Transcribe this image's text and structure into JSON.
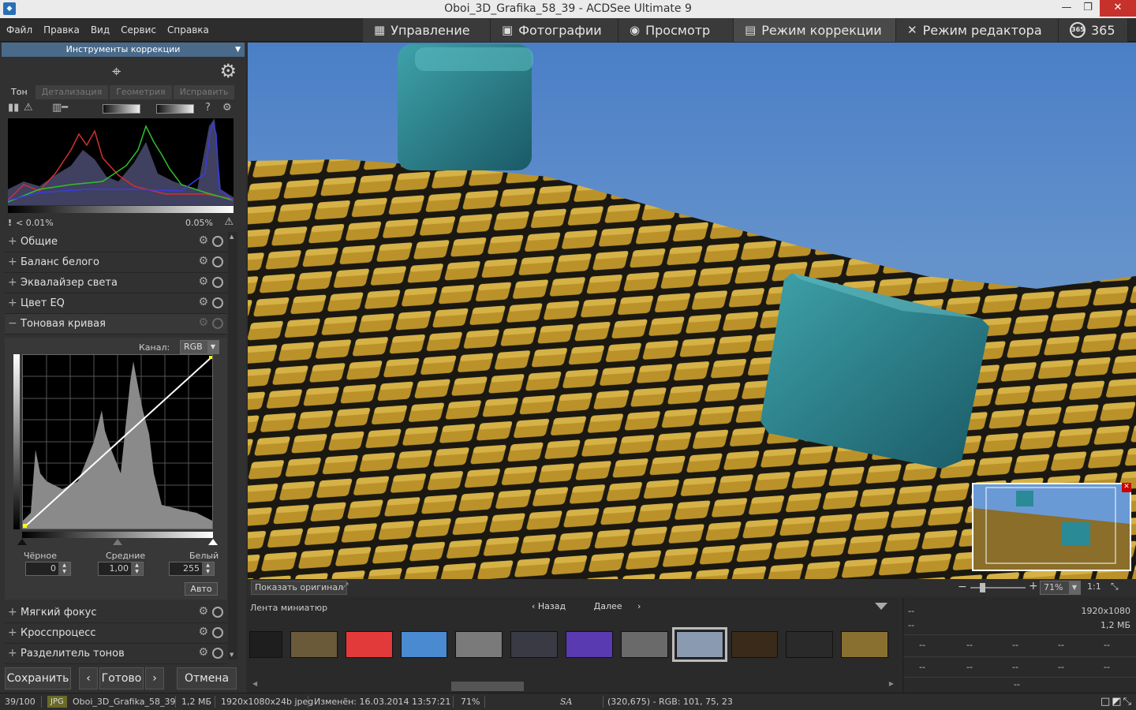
{
  "window": {
    "title": "Oboi_3D_Grafika_58_39 - ACDSee Ultimate 9",
    "min": "—",
    "max": "❐",
    "close": "✕"
  },
  "menu": [
    "Файл",
    "Правка",
    "Вид",
    "Сервис",
    "Справка"
  ],
  "modes": [
    {
      "label": "Управление",
      "icon": "grid-icon"
    },
    {
      "label": "Фотографии",
      "icon": "photos-icon"
    },
    {
      "label": "Просмотр",
      "icon": "eye-icon"
    },
    {
      "label": "Режим коррекции",
      "icon": "develop-icon",
      "active": true
    },
    {
      "label": "Режим редактора",
      "icon": "edit-tools-icon"
    },
    {
      "label": "365",
      "icon": "365-icon"
    }
  ],
  "panel": {
    "header": "Инструменты коррекции",
    "tabs": [
      "Тон",
      "Детализация",
      "Геометрия",
      "Исправить"
    ],
    "histogram": {
      "shadow_clip": "< 0.01%",
      "highlight_clip": "0.05%"
    },
    "sections_top": [
      "Общие",
      "Баланс белого",
      "Эквалайзер света",
      "Цвет EQ"
    ],
    "tone_curve": {
      "title": "Тоновая кривая",
      "channel_label": "Канал:",
      "channel_value": "RGB",
      "black_label": "Чёрное",
      "black_value": "0",
      "mid_label": "Средние",
      "mid_value": "1,00",
      "white_label": "Белый",
      "white_value": "255",
      "auto_label": "Авто"
    },
    "sections_bottom": [
      "Мягкий фокус",
      "Кросспроцесс",
      "Разделитель тонов"
    ],
    "buttons": {
      "save": "Сохранить",
      "done": "Готово",
      "cancel": "Отмена"
    }
  },
  "viewer": {
    "show_original": "Показать оригинал",
    "zoom": "71%",
    "one_to_one": "1:1"
  },
  "filmstrip": {
    "title": "Лента миниатюр",
    "back": "Назад",
    "next": "Далее",
    "thumb_colors": [
      "#1e1e1e",
      "#6a5a3a",
      "#e23a3a",
      "#4a8ad0",
      "#7a7a7a",
      "#3a3a44",
      "#5a3ab0",
      "#6a6a6a",
      "#8a9ab0",
      "#3a2a1a",
      "#2a2a2a",
      "#8a7030"
    ]
  },
  "properties": {
    "row1_left": "--",
    "row1_right": "1920x1080",
    "row2_left": "--",
    "row2_right": "1,2 МБ",
    "dash": "--"
  },
  "status": {
    "index": "39/100",
    "format": "JPG",
    "filename": "Oboi_3D_Grafika_58_39",
    "size": "1,2 МБ",
    "dims": "1920x1080x24b jpeg",
    "modified": "Изменён: 16.03.2014 13:57:21",
    "zoom": "71%",
    "sa": "SA",
    "pixel": "(320,675) - RGB: 101, 75, 23"
  },
  "colors": {
    "accent_header": "#4a6a8a",
    "sky": "#4f86d2",
    "tile_gold": "#c89a2a",
    "cube_teal": "#2a8a96"
  }
}
